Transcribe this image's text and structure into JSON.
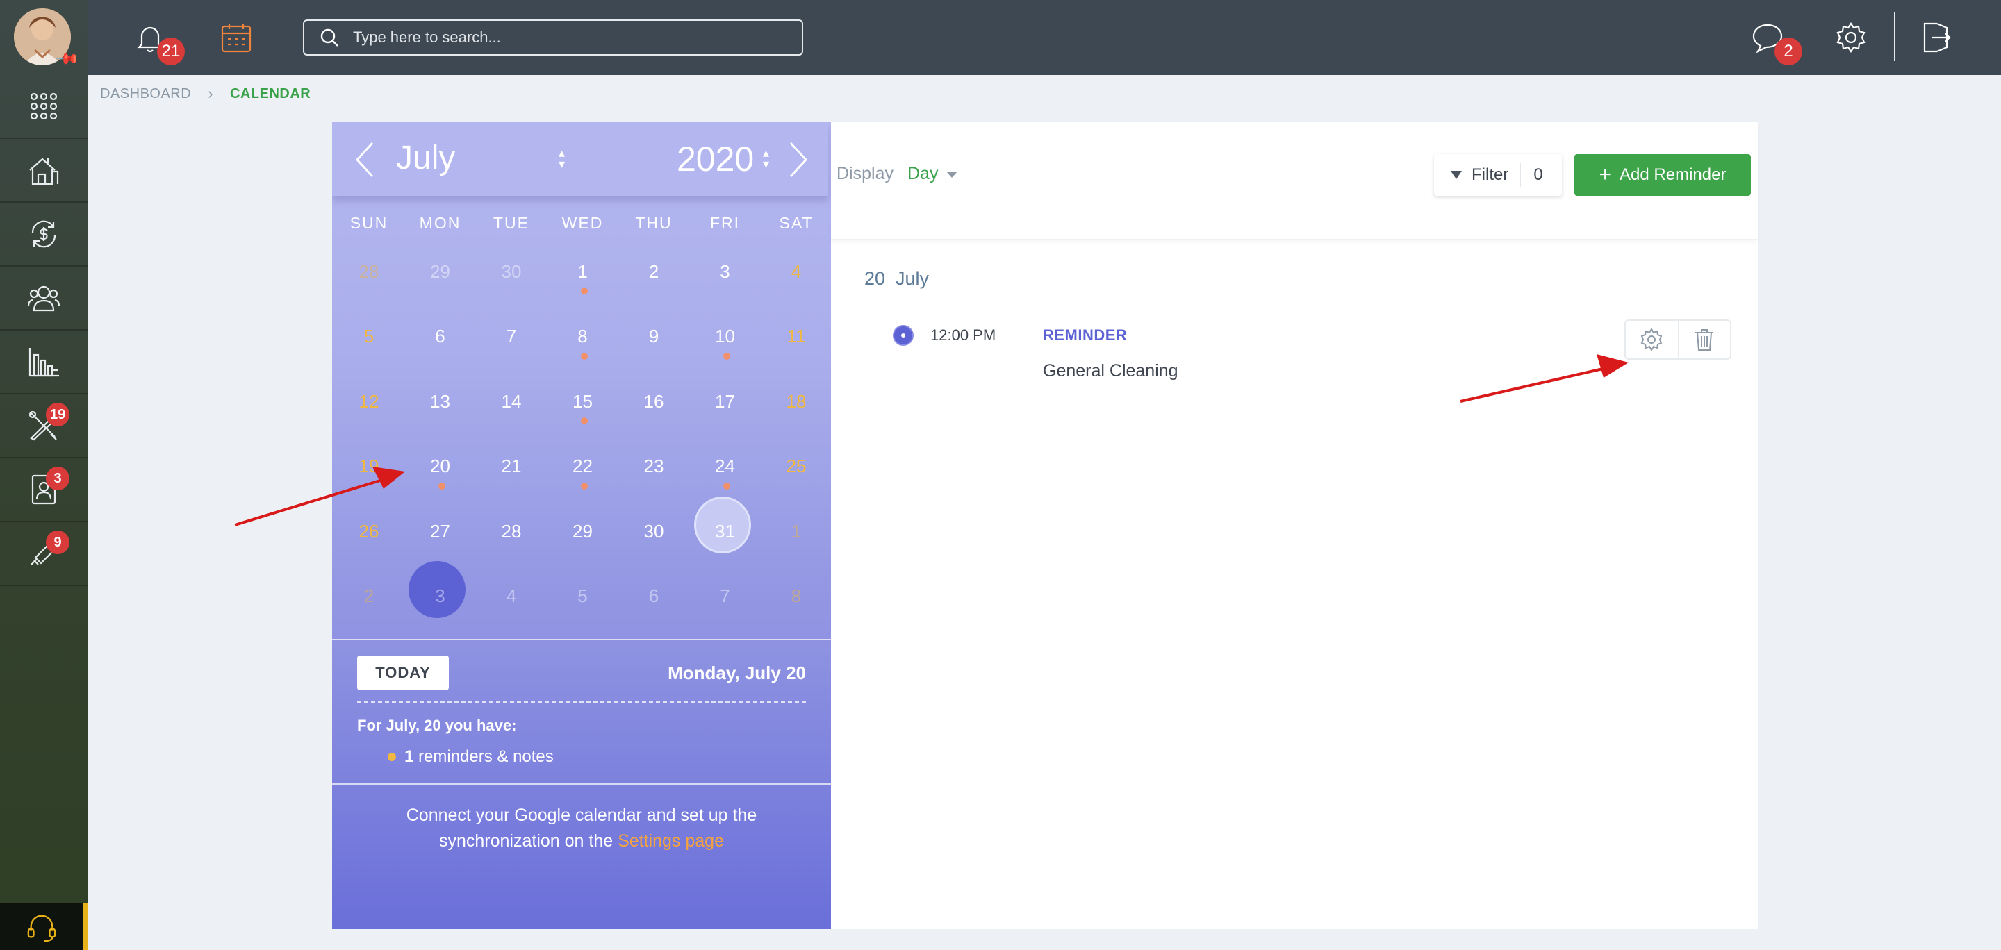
{
  "topbar": {
    "notifications_count": "21",
    "search_placeholder": "Type here to search...",
    "messages_count": "2"
  },
  "sidebar": {
    "badges": {
      "tools": "19",
      "contacts": "3",
      "marketing": "9"
    }
  },
  "breadcrumb": {
    "dashboard": "DASHBOARD",
    "calendar": "CALENDAR"
  },
  "calendar": {
    "month": "July",
    "year": "2020",
    "weekdays": [
      "SUN",
      "MON",
      "TUE",
      "WED",
      "THU",
      "FRI",
      "SAT"
    ],
    "weeks": [
      [
        "28",
        "29",
        "30",
        "1",
        "2",
        "3",
        "4"
      ],
      [
        "5",
        "6",
        "7",
        "8",
        "9",
        "10",
        "11"
      ],
      [
        "12",
        "13",
        "14",
        "15",
        "16",
        "17",
        "18"
      ],
      [
        "19",
        "20",
        "21",
        "22",
        "23",
        "24",
        "25"
      ],
      [
        "26",
        "27",
        "28",
        "29",
        "30",
        "31",
        "1"
      ],
      [
        "2",
        "3",
        "4",
        "5",
        "6",
        "7",
        "8"
      ]
    ],
    "today_label": "TODAY",
    "selected_date_full": "Monday, July 20",
    "summary_intro": "For July, 20 you have:",
    "summary_count": "1",
    "summary_text": " reminders & notes",
    "connect_text_1": "Connect your Google calendar and set up the",
    "connect_text_2": "synchronization on the ",
    "settings_link": "Settings page",
    "colors": {
      "selected": "#5c61d4",
      "weekend": "#f0b840",
      "event_dot": "#f2906a"
    }
  },
  "main": {
    "display_label": "Display",
    "display_value": "Day",
    "filter_label": "Filter",
    "filter_count": "0",
    "add_label": "Add Reminder",
    "day_title": "20  July",
    "events": [
      {
        "time": "12:00 PM",
        "type": "REMINDER",
        "name": "General Cleaning"
      }
    ]
  }
}
